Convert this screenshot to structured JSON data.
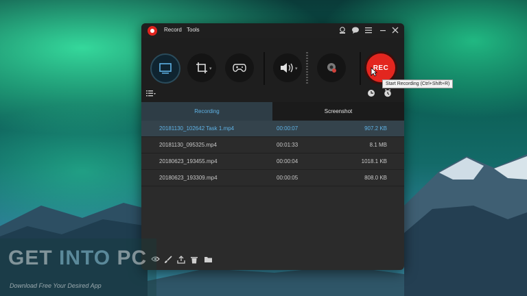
{
  "window": {
    "menu": [
      "Record",
      "Tools"
    ],
    "title_icons": [
      "webcam-icon",
      "chat-icon",
      "hamburger-menu-icon",
      "minimize-icon",
      "close-icon"
    ]
  },
  "toolbar": {
    "buttons": [
      "screen-record-icon",
      "crop-region-icon",
      "gamepad-icon",
      "speaker-icon",
      "webcam-off-icon"
    ],
    "rec_label": "REC",
    "tooltip": "Start Recording (Ctrl+Shift+R)",
    "sub_icons": [
      "list-view-icon",
      "timer-icon",
      "schedule-icon"
    ]
  },
  "tabs": {
    "recording": "Recording",
    "screenshot": "Screenshot"
  },
  "files": [
    {
      "name": "20181130_102642 Task 1.mp4",
      "duration": "00:00:07",
      "size": "907.2 KB",
      "selected": true
    },
    {
      "name": "20181130_095325.mp4",
      "duration": "00:01:33",
      "size": "8.1 MB",
      "selected": false
    },
    {
      "name": "20180623_193455.mp4",
      "duration": "00:00:04",
      "size": "1018.1 KB",
      "selected": false
    },
    {
      "name": "20180623_193309.mp4",
      "duration": "00:00:05",
      "size": "808.0 KB",
      "selected": false
    }
  ],
  "bottom_icons": [
    "preview-eye-icon",
    "edit-brush-icon",
    "share-upload-icon",
    "delete-trash-icon",
    "open-folder-icon"
  ],
  "watermark": {
    "get": "GET ",
    "into": "INTO",
    "pc": " PC",
    "tagline": "Download Free Your Desired App"
  },
  "colors": {
    "accent_blue": "#5fb3e6",
    "rec_red": "#e3261f",
    "window_bg": "#2b2b2b"
  }
}
